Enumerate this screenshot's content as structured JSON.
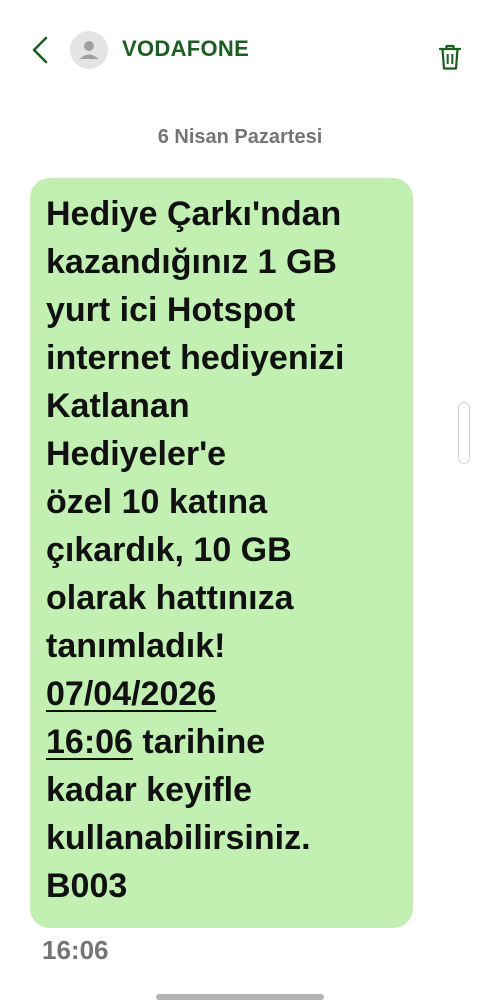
{
  "header": {
    "contact_name": "VODAFONE",
    "back_icon": "chevron-left-icon",
    "avatar_icon": "person-icon",
    "delete_icon": "trash-icon",
    "accent_color": "#1b5e20"
  },
  "conversation": {
    "date_divider": "6 Nisan Pazartesi",
    "message": {
      "text_before": "Hediye Çarkı'ndan\nkazandığınız 1 GB\nyurt ici Hotspot\ninternet hediyenizi\nKatlanan\nHediyeler'e\nözel 10 katına\nçıkardık, 10 GB\nolarak hattınıza\ntanımladık!\n",
      "date_link": "07/04/2026\n16:06",
      "text_after": " tarihine\nkadar keyifle\nkullanabilirsiniz.\nB003",
      "bubble_color": "#c2f0b2",
      "time": "16:06"
    }
  }
}
